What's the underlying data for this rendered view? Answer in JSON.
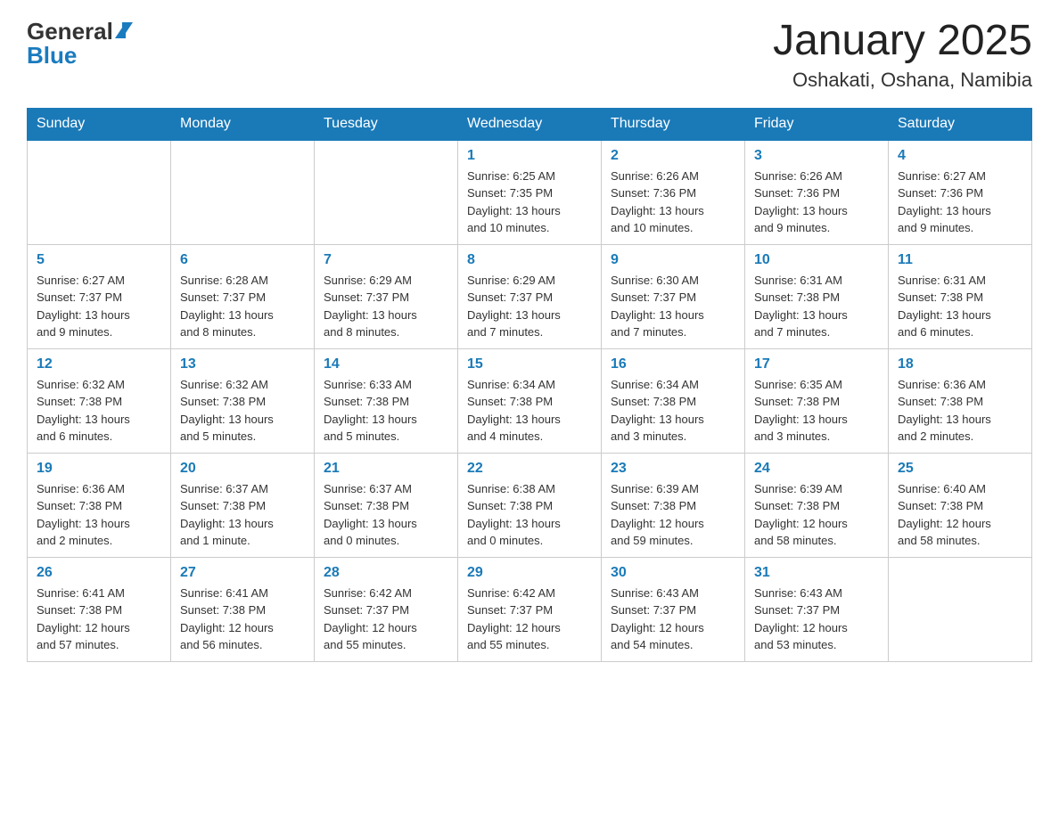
{
  "header": {
    "logo_general": "General",
    "logo_blue": "Blue",
    "title": "January 2025",
    "subtitle": "Oshakati, Oshana, Namibia"
  },
  "days_of_week": [
    "Sunday",
    "Monday",
    "Tuesday",
    "Wednesday",
    "Thursday",
    "Friday",
    "Saturday"
  ],
  "weeks": [
    [
      {
        "day": "",
        "info": ""
      },
      {
        "day": "",
        "info": ""
      },
      {
        "day": "",
        "info": ""
      },
      {
        "day": "1",
        "info": "Sunrise: 6:25 AM\nSunset: 7:35 PM\nDaylight: 13 hours\nand 10 minutes."
      },
      {
        "day": "2",
        "info": "Sunrise: 6:26 AM\nSunset: 7:36 PM\nDaylight: 13 hours\nand 10 minutes."
      },
      {
        "day": "3",
        "info": "Sunrise: 6:26 AM\nSunset: 7:36 PM\nDaylight: 13 hours\nand 9 minutes."
      },
      {
        "day": "4",
        "info": "Sunrise: 6:27 AM\nSunset: 7:36 PM\nDaylight: 13 hours\nand 9 minutes."
      }
    ],
    [
      {
        "day": "5",
        "info": "Sunrise: 6:27 AM\nSunset: 7:37 PM\nDaylight: 13 hours\nand 9 minutes."
      },
      {
        "day": "6",
        "info": "Sunrise: 6:28 AM\nSunset: 7:37 PM\nDaylight: 13 hours\nand 8 minutes."
      },
      {
        "day": "7",
        "info": "Sunrise: 6:29 AM\nSunset: 7:37 PM\nDaylight: 13 hours\nand 8 minutes."
      },
      {
        "day": "8",
        "info": "Sunrise: 6:29 AM\nSunset: 7:37 PM\nDaylight: 13 hours\nand 7 minutes."
      },
      {
        "day": "9",
        "info": "Sunrise: 6:30 AM\nSunset: 7:37 PM\nDaylight: 13 hours\nand 7 minutes."
      },
      {
        "day": "10",
        "info": "Sunrise: 6:31 AM\nSunset: 7:38 PM\nDaylight: 13 hours\nand 7 minutes."
      },
      {
        "day": "11",
        "info": "Sunrise: 6:31 AM\nSunset: 7:38 PM\nDaylight: 13 hours\nand 6 minutes."
      }
    ],
    [
      {
        "day": "12",
        "info": "Sunrise: 6:32 AM\nSunset: 7:38 PM\nDaylight: 13 hours\nand 6 minutes."
      },
      {
        "day": "13",
        "info": "Sunrise: 6:32 AM\nSunset: 7:38 PM\nDaylight: 13 hours\nand 5 minutes."
      },
      {
        "day": "14",
        "info": "Sunrise: 6:33 AM\nSunset: 7:38 PM\nDaylight: 13 hours\nand 5 minutes."
      },
      {
        "day": "15",
        "info": "Sunrise: 6:34 AM\nSunset: 7:38 PM\nDaylight: 13 hours\nand 4 minutes."
      },
      {
        "day": "16",
        "info": "Sunrise: 6:34 AM\nSunset: 7:38 PM\nDaylight: 13 hours\nand 3 minutes."
      },
      {
        "day": "17",
        "info": "Sunrise: 6:35 AM\nSunset: 7:38 PM\nDaylight: 13 hours\nand 3 minutes."
      },
      {
        "day": "18",
        "info": "Sunrise: 6:36 AM\nSunset: 7:38 PM\nDaylight: 13 hours\nand 2 minutes."
      }
    ],
    [
      {
        "day": "19",
        "info": "Sunrise: 6:36 AM\nSunset: 7:38 PM\nDaylight: 13 hours\nand 2 minutes."
      },
      {
        "day": "20",
        "info": "Sunrise: 6:37 AM\nSunset: 7:38 PM\nDaylight: 13 hours\nand 1 minute."
      },
      {
        "day": "21",
        "info": "Sunrise: 6:37 AM\nSunset: 7:38 PM\nDaylight: 13 hours\nand 0 minutes."
      },
      {
        "day": "22",
        "info": "Sunrise: 6:38 AM\nSunset: 7:38 PM\nDaylight: 13 hours\nand 0 minutes."
      },
      {
        "day": "23",
        "info": "Sunrise: 6:39 AM\nSunset: 7:38 PM\nDaylight: 12 hours\nand 59 minutes."
      },
      {
        "day": "24",
        "info": "Sunrise: 6:39 AM\nSunset: 7:38 PM\nDaylight: 12 hours\nand 58 minutes."
      },
      {
        "day": "25",
        "info": "Sunrise: 6:40 AM\nSunset: 7:38 PM\nDaylight: 12 hours\nand 58 minutes."
      }
    ],
    [
      {
        "day": "26",
        "info": "Sunrise: 6:41 AM\nSunset: 7:38 PM\nDaylight: 12 hours\nand 57 minutes."
      },
      {
        "day": "27",
        "info": "Sunrise: 6:41 AM\nSunset: 7:38 PM\nDaylight: 12 hours\nand 56 minutes."
      },
      {
        "day": "28",
        "info": "Sunrise: 6:42 AM\nSunset: 7:37 PM\nDaylight: 12 hours\nand 55 minutes."
      },
      {
        "day": "29",
        "info": "Sunrise: 6:42 AM\nSunset: 7:37 PM\nDaylight: 12 hours\nand 55 minutes."
      },
      {
        "day": "30",
        "info": "Sunrise: 6:43 AM\nSunset: 7:37 PM\nDaylight: 12 hours\nand 54 minutes."
      },
      {
        "day": "31",
        "info": "Sunrise: 6:43 AM\nSunset: 7:37 PM\nDaylight: 12 hours\nand 53 minutes."
      },
      {
        "day": "",
        "info": ""
      }
    ]
  ]
}
